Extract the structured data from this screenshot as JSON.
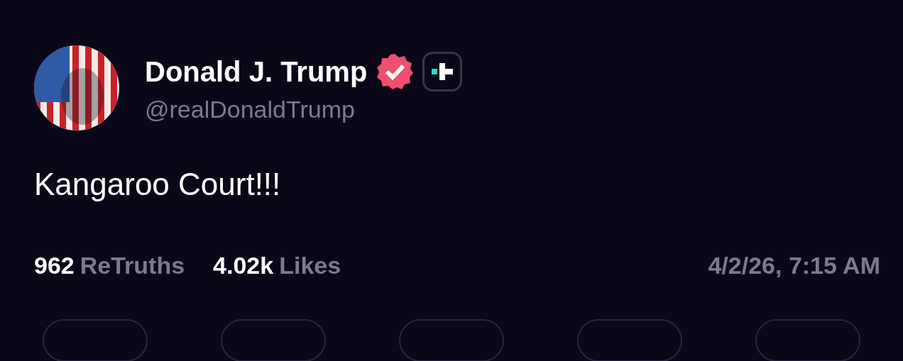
{
  "author": {
    "name": "Donald J. Trump",
    "handle": "@realDonaldTrump",
    "verified": true,
    "plus_badge": true
  },
  "post": {
    "text": "Kangaroo Court!!!"
  },
  "stats": [
    {
      "count": "962",
      "label": "ReTruths"
    },
    {
      "count": "4.02k",
      "label": "Likes"
    }
  ],
  "timestamp": "4/2/26, 7:15 AM"
}
